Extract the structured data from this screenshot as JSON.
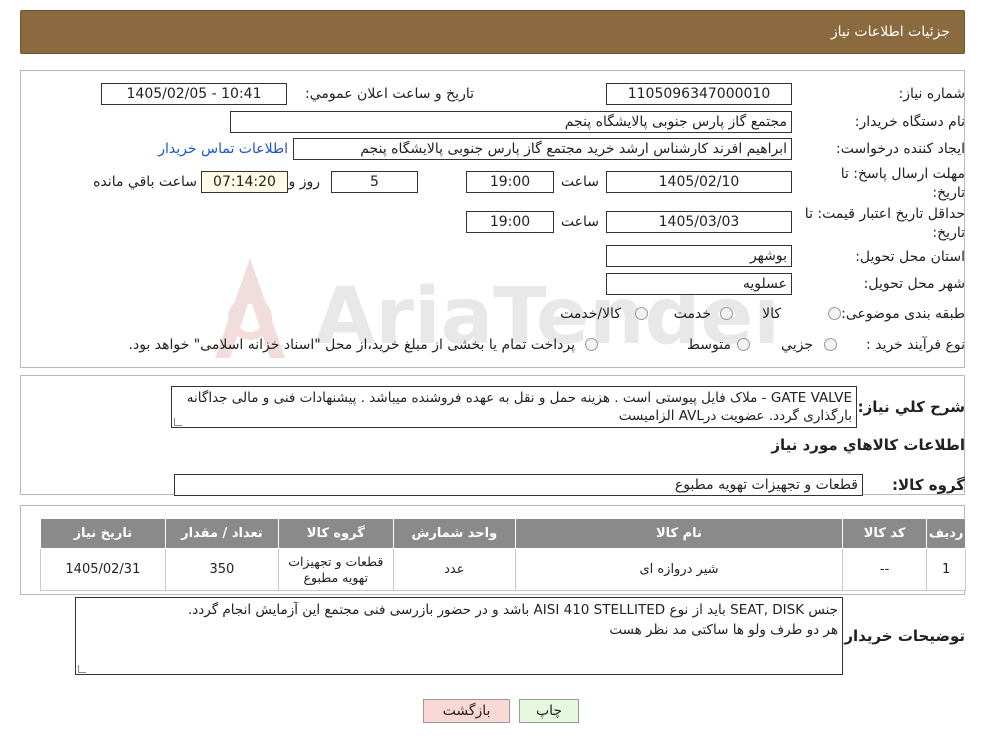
{
  "header": {
    "title": "جزئیات اطلاعات نیاز"
  },
  "fields": {
    "need_number_label": "شماره نیاز:",
    "need_number": "1105096347000010",
    "announce_label": "تاریخ و ساعت اعلان عمومي:",
    "announce_value": "1405/02/05 - 10:41",
    "buyer_org_label": "نام دستگاه خریدار:",
    "buyer_org": "مجتمع گاز پارس جنوبی  پالایشگاه پنجم",
    "creator_label": "ایجاد کننده درخواست:",
    "creator": "ابراهیم افرند کارشناس ارشد خرید مجتمع گاز پارس جنوبی  پالایشگاه پنجم",
    "contact_link": "اطلاعات تماس خریدار",
    "deadline_label": "مهلت ارسال پاسخ: تا تاریخ:",
    "deadline_date": "1405/02/10",
    "time_word": "ساعت",
    "deadline_time": "19:00",
    "days": "5",
    "days_word": "روز و",
    "remaining": "07:14:20",
    "remaining_word": "ساعت باقي مانده",
    "validity_label": "حداقل تاریخ اعتبار قیمت: تا تاریخ:",
    "validity_date": "1405/03/03",
    "validity_time": "19:00",
    "province_label": "استان محل تحویل:",
    "province": "بوشهر",
    "city_label": "شهر محل تحویل:",
    "city": "عسلویه",
    "category_label": "طبقه بندی موضوعی:",
    "cat_goods": "کالا",
    "cat_service": "خدمت",
    "cat_both": "کالا/خدمت",
    "process_label": "نوع فرآیند خرید :",
    "proc_partial": "جزیي",
    "proc_medium": "متوسط",
    "proc_note": "پرداخت تمام یا بخشی از مبلغ خرید،از محل \"اسناد خزانه اسلامی\" خواهد بود."
  },
  "summary": {
    "label": "شرح کلي نیاز:",
    "text": "GATE VALVE - ملاک فایل پیوستی است . هزینه حمل و نقل به عهده فروشنده میباشد . پیشنهادات فنی و مالی جداگانه بارگذاری گردد. عضویت درAVL الزامیست"
  },
  "goods_section_title": "اطلاعات کالاهاي مورد نیاز",
  "goods_group_label": "گروه کالا:",
  "goods_group": "قطعات و تجهیزات تهویه مطبوع",
  "table": {
    "headers": [
      "ردیف",
      "کد کالا",
      "نام کالا",
      "واحد شمارش",
      "گروه کالا",
      "تعداد / مقدار",
      "تاریخ نیاز"
    ],
    "rows": [
      [
        "1",
        "--",
        "شیر دروازه ای",
        "عدد",
        "قطعات و تجهیزات تهویه مطبوع",
        "350",
        "1405/02/31"
      ]
    ]
  },
  "buyer_notes": {
    "label": "توضیحات خریدار:",
    "line1": "جنس SEAT, DISK باید از نوع AISI 410 STELLITED  باشد و در حضور بازرسی فنی مجتمع این آزمایش انجام گردد.",
    "line2": "هر دو طرف ولو ها ساکتی مد نظر هست"
  },
  "buttons": {
    "print": "چاپ",
    "back": "بازگشت"
  },
  "watermark": "AriaTender.neT",
  "colors": {
    "header_bg": "#8b6a3f",
    "link": "#1a55c9",
    "back_btn": "#fbd8d8",
    "print_btn": "#e6f7df"
  }
}
